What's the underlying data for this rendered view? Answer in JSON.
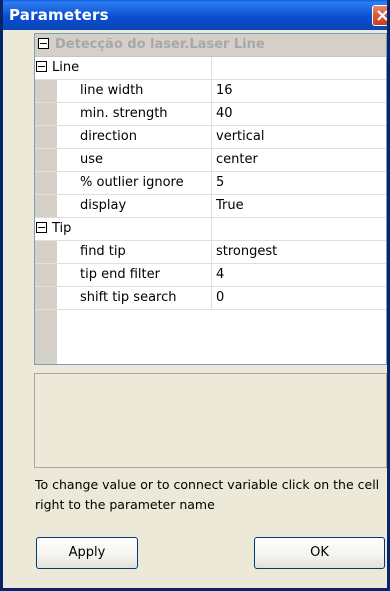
{
  "window": {
    "title": "Parameters"
  },
  "grid": {
    "header": "Detecção do laser.Laser Line",
    "groups": [
      {
        "name": "Line",
        "rows": [
          {
            "name": "line width",
            "value": "16"
          },
          {
            "name": "min. strength",
            "value": "40"
          },
          {
            "name": "direction",
            "value": "vertical"
          },
          {
            "name": "use",
            "value": "center"
          },
          {
            "name": "% outlier ignore",
            "value": "5"
          },
          {
            "name": "display",
            "value": "True"
          }
        ]
      },
      {
        "name": "Tip",
        "rows": [
          {
            "name": "find tip",
            "value": "strongest"
          },
          {
            "name": "tip end filter",
            "value": "4"
          },
          {
            "name": "shift tip search",
            "value": "0"
          }
        ]
      }
    ]
  },
  "hint": "To change value or to connect variable click on the cell right to the parameter name",
  "buttons": {
    "apply": "Apply",
    "ok": "OK"
  },
  "colors": {
    "titlebar": "#0a4fd0",
    "window_bg": "#ece9d8",
    "gutter": "#d4d0c8",
    "header_text": "#a8a8a8"
  }
}
